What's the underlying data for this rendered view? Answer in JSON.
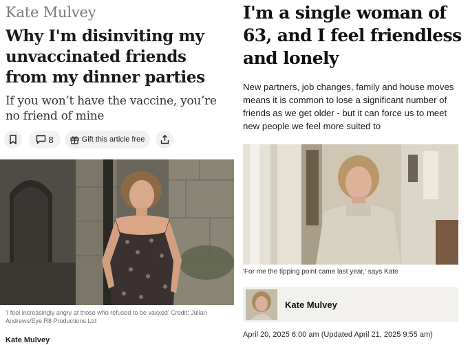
{
  "left_article": {
    "author": "Kate Mulvey",
    "headline": "Why I'm disinviting my unvaccinated friends from my dinner parties",
    "standfirst": "If you won’t have the vaccine, you’re no friend of mine",
    "toolbar": {
      "bookmark_icon": "bookmark-icon",
      "comment_icon": "comment-icon",
      "comment_count": "8",
      "gift_icon": "gift-icon",
      "gift_label": "Gift this article free",
      "share_icon": "share-icon"
    },
    "photo_caption": "'I feel increasingly angry at those who refused to be vaxxed'  Credit: Julian Andrews/Eye R8 Productions Ltd",
    "byline": "Kate Mulvey"
  },
  "right_article": {
    "headline": "I'm a single woman of 63, and I feel friendless and lonely",
    "standfirst": "New partners, job changes, family and house moves means it is common to lose a significant number of friends as we get older - but it can force us to meet new people we feel more suited to",
    "photo_caption": "'For me the tipping point came last year,' says Kate",
    "author_name": "Kate Mulvey",
    "dateline": "April 20, 2025 6:00 am (Updated April 21, 2025 9:55 am)"
  }
}
